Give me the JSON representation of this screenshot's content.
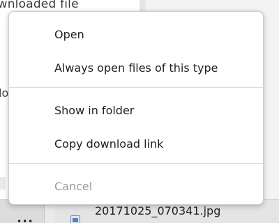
{
  "background": {
    "title_fragment": "ownloaded file",
    "side_fragment": "lo"
  },
  "menu": {
    "items": [
      {
        "label": "Open",
        "enabled": true
      },
      {
        "label": "Always open files of this type",
        "enabled": true
      },
      {
        "label": "Show in folder",
        "enabled": true
      },
      {
        "label": "Copy download link",
        "enabled": true
      },
      {
        "label": "Cancel",
        "enabled": false
      }
    ]
  },
  "shelf": {
    "file_name": "20171025_070341.jpg",
    "file_icon": "image-file-icon",
    "more_icon": "more-dots-icon"
  }
}
